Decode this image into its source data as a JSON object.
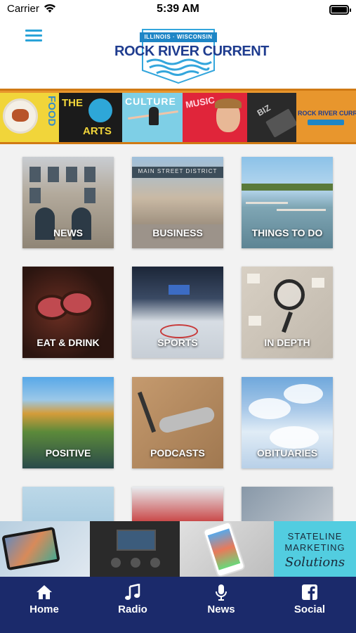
{
  "status_bar": {
    "carrier": "Carrier",
    "time": "5:39 AM"
  },
  "header": {
    "logo_tag": "ILLINOIS · WISCONSIN",
    "logo_title": "ROCK RIVER CURRENT"
  },
  "banner": {
    "food": "FOOD",
    "the": "THE",
    "arts": "ARTS",
    "culture": "CULTURE",
    "music": "MUSIC",
    "biz": "BIZ",
    "logo": "ROCK RIVER CURRENT"
  },
  "tiles": [
    {
      "label": "NEWS"
    },
    {
      "label": "BUSINESS",
      "sign": "MAIN STREET DISTRICT"
    },
    {
      "label": "THINGS TO DO"
    },
    {
      "label": "EAT & DRINK"
    },
    {
      "label": "SPORTS"
    },
    {
      "label": "IN DEPTH"
    },
    {
      "label": "POSITIVE"
    },
    {
      "label": "PODCASTS"
    },
    {
      "label": "OBITUARIES"
    }
  ],
  "ad": {
    "line1": "STATELINE",
    "line2": "MARKETING",
    "line3": "Solutions"
  },
  "tabbar": {
    "items": [
      {
        "label": "Home",
        "icon": "home-icon"
      },
      {
        "label": "Radio",
        "icon": "music-note-icon"
      },
      {
        "label": "News",
        "icon": "microphone-icon"
      },
      {
        "label": "Social",
        "icon": "facebook-icon"
      }
    ]
  },
  "colors": {
    "tabbar_bg": "#1b2a6b",
    "accent_blue": "#2aa3d8",
    "logo_navy": "#1f3c8f",
    "banner_orange": "#e8962d"
  }
}
